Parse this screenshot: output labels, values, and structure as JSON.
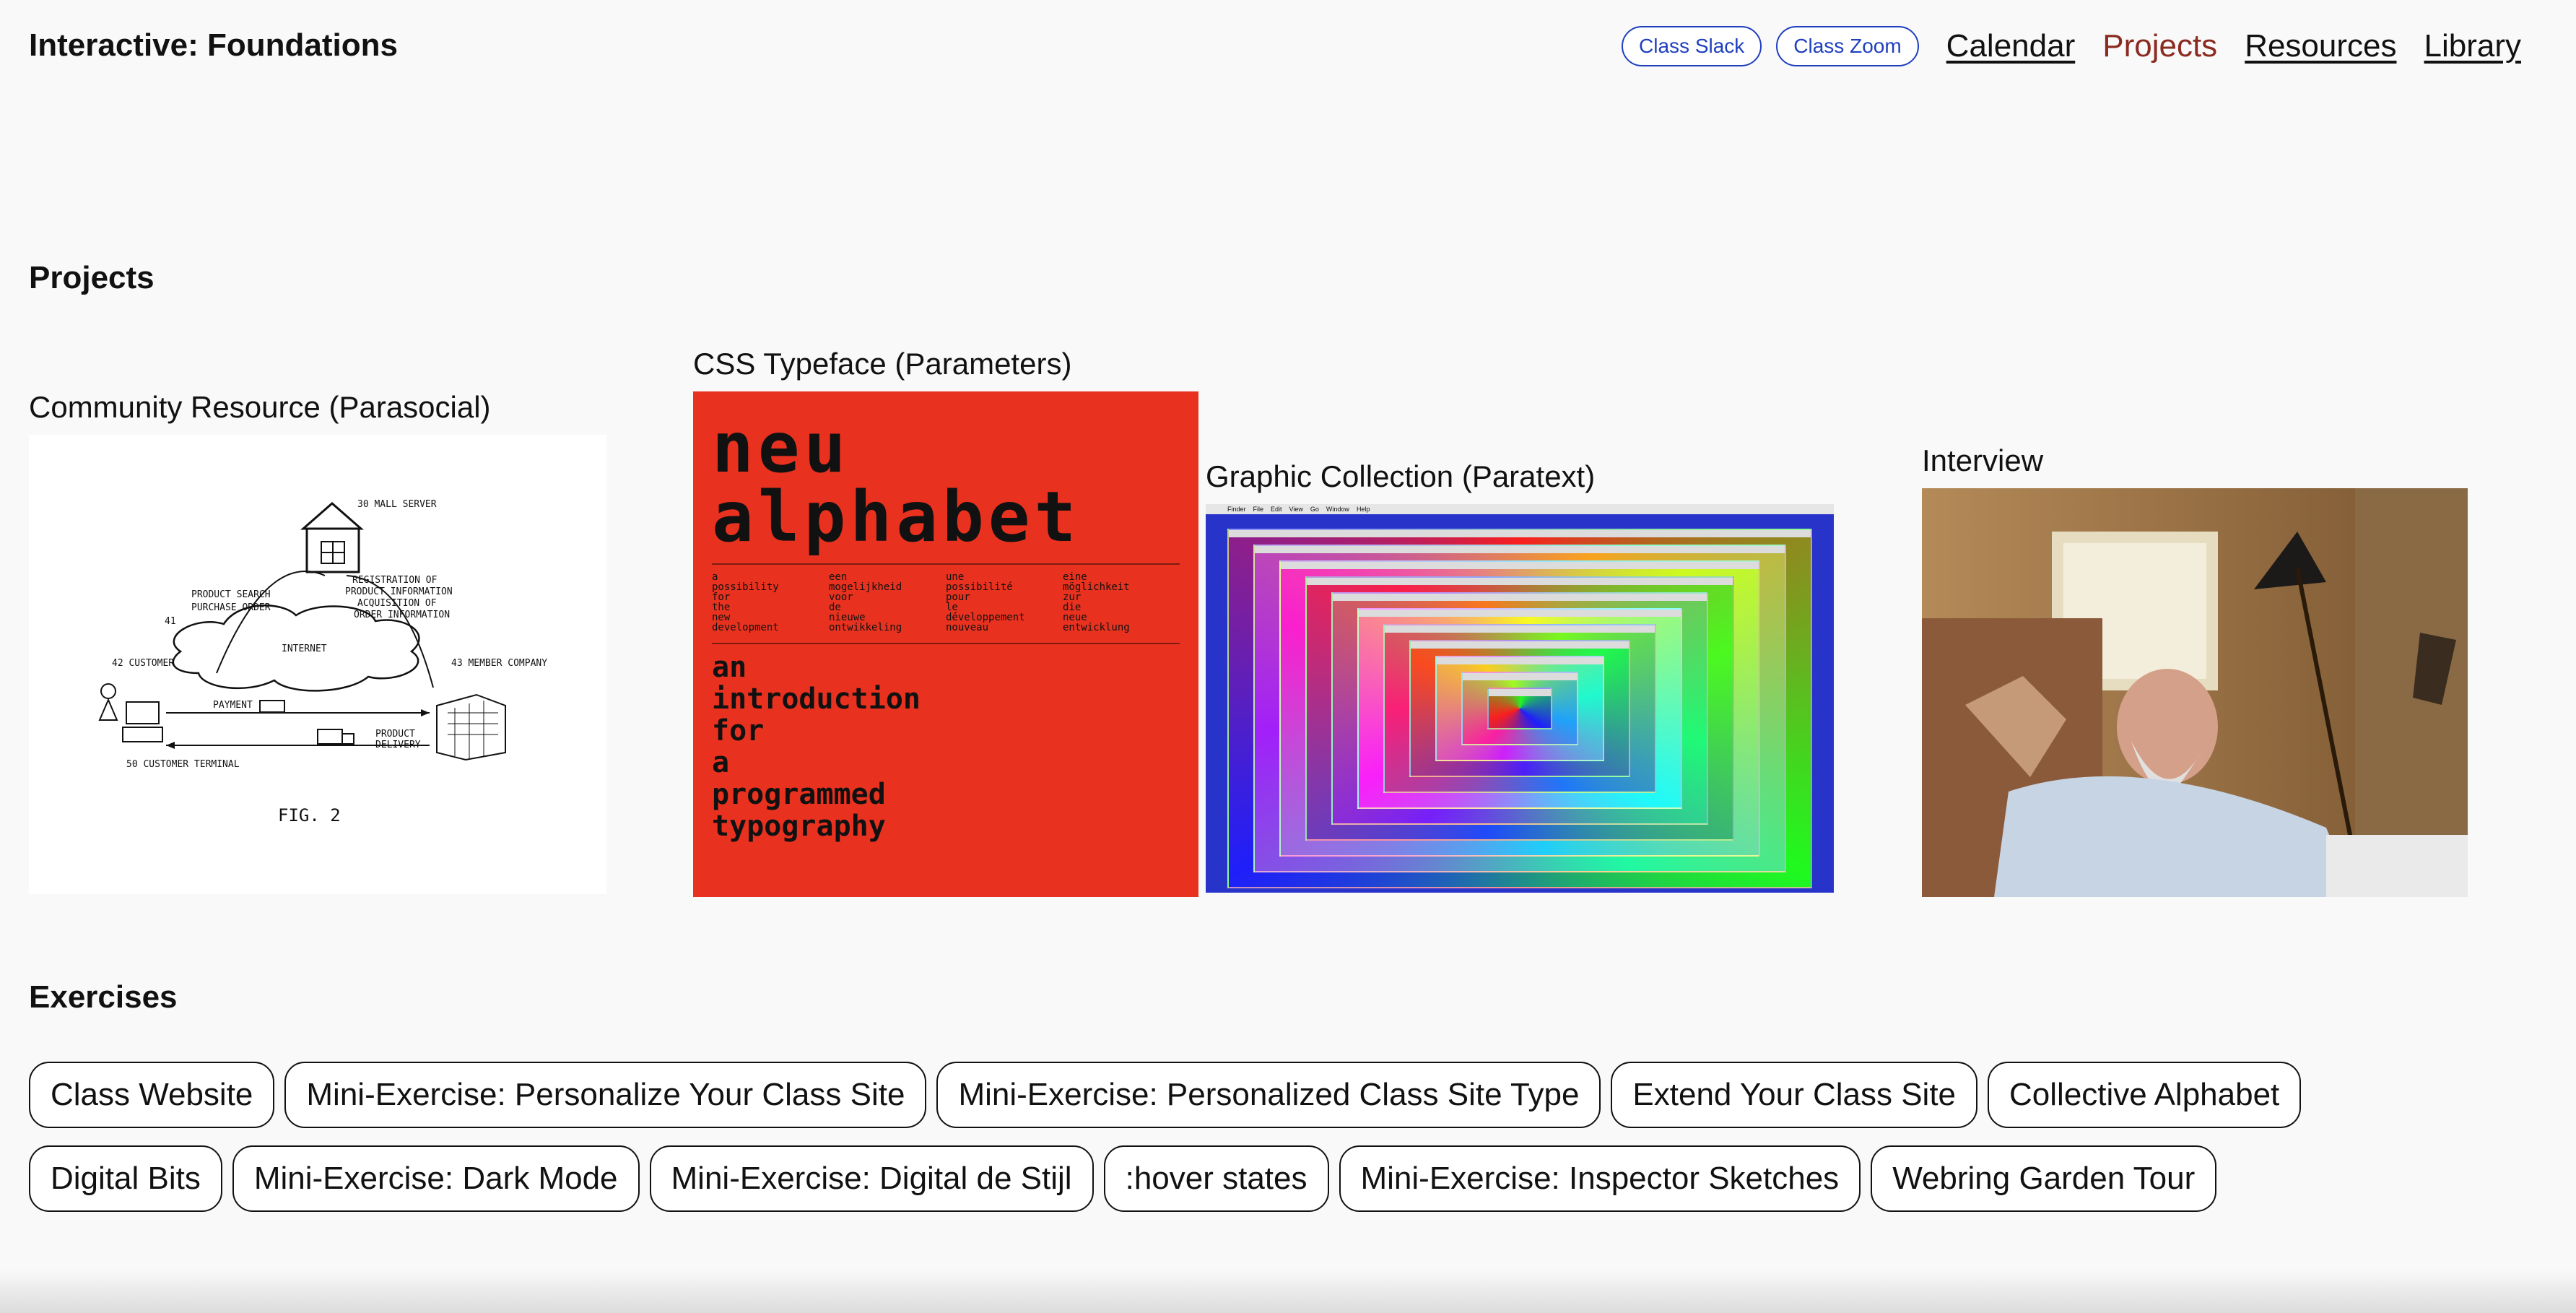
{
  "site": {
    "title": "Interactive: Foundations"
  },
  "header": {
    "pills": [
      "Class Slack",
      "Class Zoom"
    ],
    "nav": [
      "Calendar",
      "Projects",
      "Resources",
      "Library"
    ],
    "active_nav": "Projects",
    "colors": {
      "pill_border": "#1f3fbf",
      "active_link": "#8b2a20"
    }
  },
  "projects_heading": "Projects",
  "projects": [
    {
      "title": "Community Resource (Parasocial)",
      "thumb": "patent-diagram",
      "diagram_labels": [
        "30 MALL SERVER",
        "PRODUCT SEARCH",
        "PURCHASE ORDER",
        "REGISTRATION OF",
        "PRODUCT INFORMATION",
        "ACQUISITION OF",
        "ORDER INFORMATION",
        "41",
        "INTERNET",
        "42 CUSTOMER",
        "43 MEMBER COMPANY",
        "PAYMENT",
        "PRODUCT",
        "DELIVERY",
        "50 CUSTOMER TERMINAL",
        "FIG. 2"
      ]
    },
    {
      "title": "CSS Typeface (Parameters)",
      "thumb": "typeface-poster",
      "poster_big": [
        "neu",
        "alphabet"
      ],
      "poster_small": [
        [
          "a",
          "possibility",
          "for",
          "the",
          "new",
          "development"
        ],
        [
          "een",
          "mogelijkheid",
          "voor",
          "de",
          "nieuwe",
          "ontwikkeling"
        ],
        [
          "une",
          "possibilité",
          "pour",
          "le",
          "développement",
          "nouveau"
        ],
        [
          "eine",
          "möglichkeit",
          "zur",
          "die",
          "neue",
          "entwicklung"
        ]
      ],
      "poster_intro": [
        "an",
        "introduction",
        "for",
        "a",
        "programmed",
        "typography"
      ]
    },
    {
      "title": "Graphic Collection (Paratext)",
      "thumb": "nested-windows",
      "menu_items": [
        "Finder",
        "File",
        "Edit",
        "View",
        "Go",
        "Window",
        "Help"
      ]
    },
    {
      "title": "Interview",
      "thumb": "interview-photo"
    }
  ],
  "exercises_heading": "Exercises",
  "exercises": [
    [
      "Class Website",
      "Mini-Exercise: Personalize Your Class Site",
      "Mini-Exercise: Personalized Class Site Type",
      "Extend Your Class Site",
      "Collective Alphabet"
    ],
    [
      "Digital Bits",
      "Mini-Exercise: Dark Mode",
      "Mini-Exercise: Digital de Stijl",
      ":hover states",
      "Mini-Exercise: Inspector Sketches",
      "Webring Garden Tour"
    ]
  ]
}
